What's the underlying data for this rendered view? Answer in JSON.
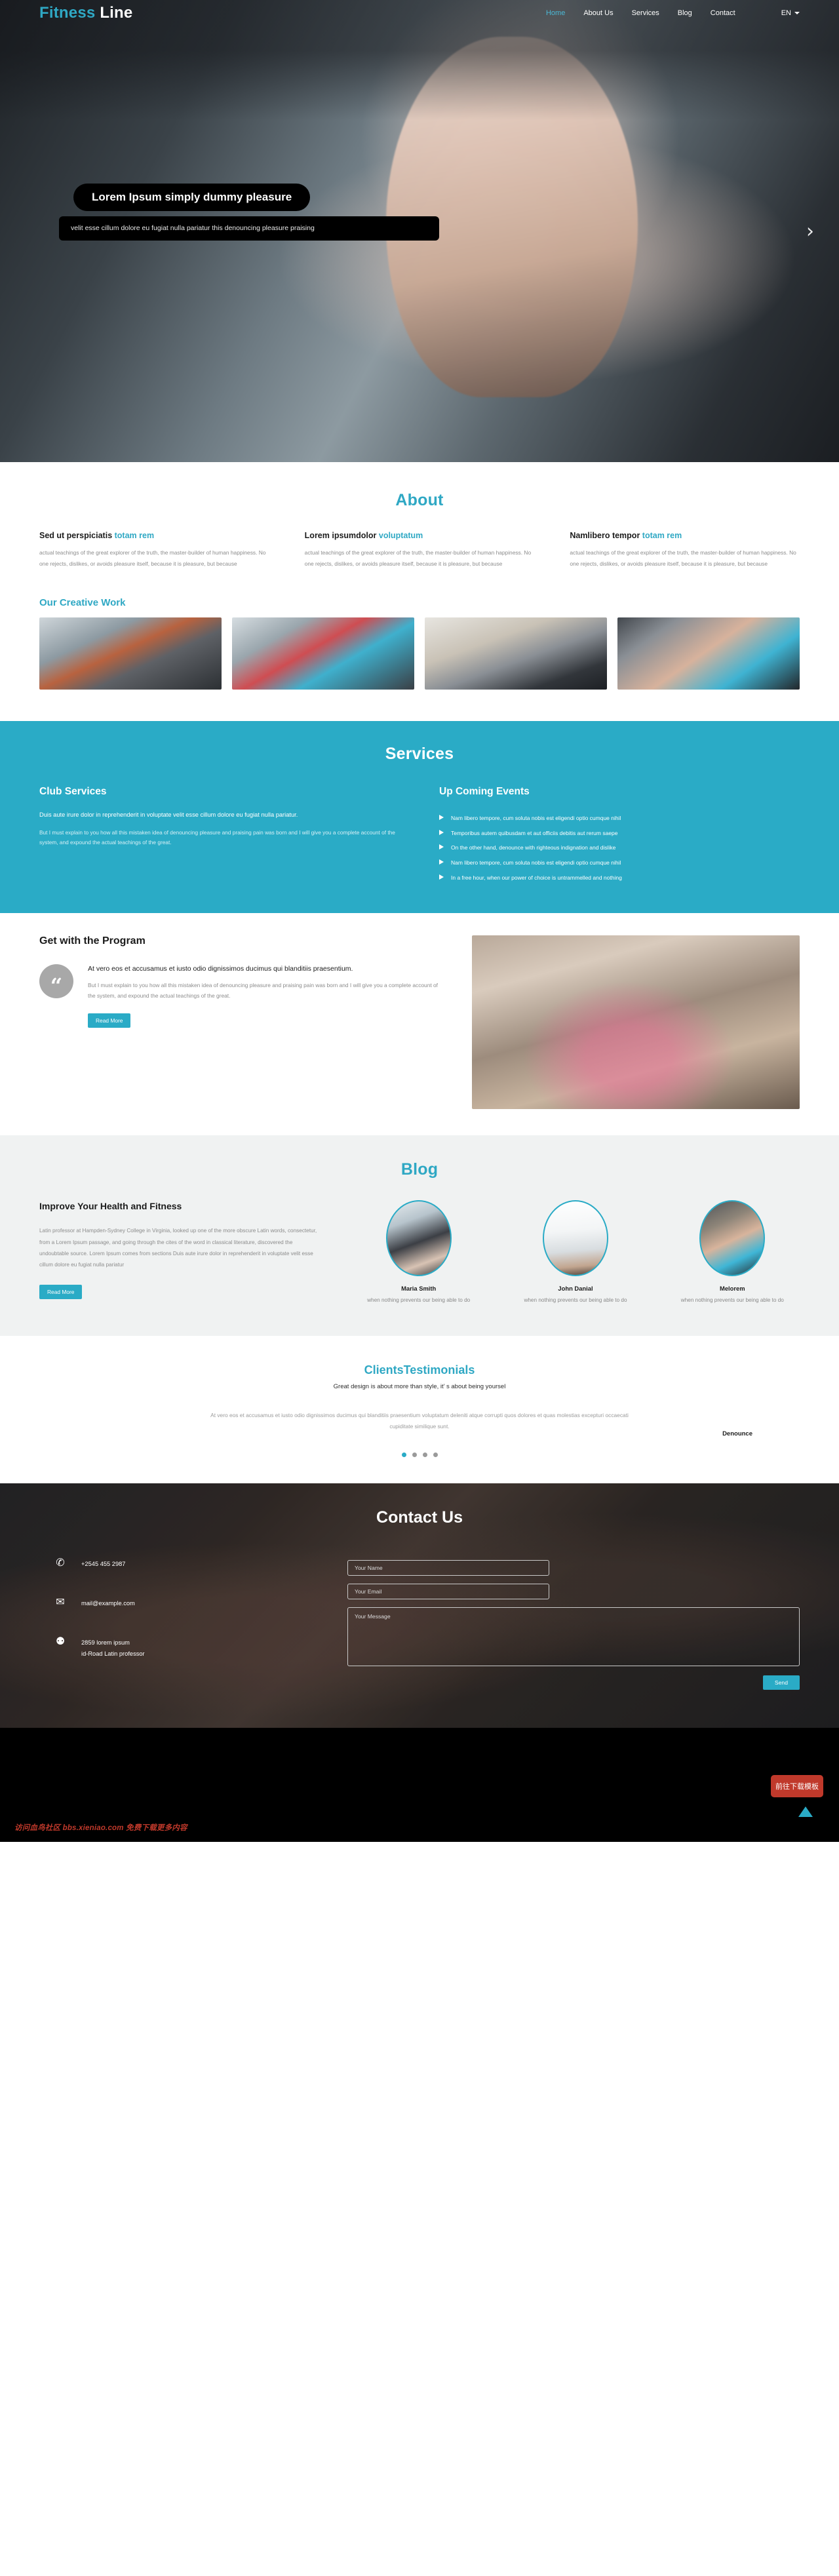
{
  "header": {
    "brand_first": "Fitness",
    "brand_second": "Line",
    "nav": [
      {
        "label": "Home",
        "active": true
      },
      {
        "label": "About Us",
        "active": false
      },
      {
        "label": "Services",
        "active": false
      },
      {
        "label": "Blog",
        "active": false
      },
      {
        "label": "Contact",
        "active": false
      }
    ],
    "lang": "EN"
  },
  "hero": {
    "title": "Lorem Ipsum simply dummy pleasure",
    "subtitle": "velit esse cillum dolore eu fugiat nulla pariatur this denouncing pleasure praising",
    "next_arrow": "›"
  },
  "about": {
    "title": "About",
    "columns": [
      {
        "heading_plain": "Sed ut perspiciatis ",
        "heading_accent": "totam rem",
        "body": "actual teachings of the great explorer of the truth, the master-builder of human happiness. No one rejects, dislikes, or avoids pleasure itself, because it is pleasure, but because"
      },
      {
        "heading_plain": "Lorem ipsumdolor ",
        "heading_accent": "voluptatum",
        "body": "actual teachings of the great explorer of the truth, the master-builder of human happiness. No one rejects, dislikes, or avoids pleasure itself, because it is pleasure, but because"
      },
      {
        "heading_plain": "Namlibero tempor ",
        "heading_accent": "totam rem",
        "body": "actual teachings of the great explorer of the truth, the master-builder of human happiness. No one rejects, dislikes, or avoids pleasure itself, because it is pleasure, but because"
      }
    ],
    "work_title": "Our Creative Work",
    "gallery": [
      {
        "name": "treadmill-gym-photo"
      },
      {
        "name": "barbell-class-photo"
      },
      {
        "name": "crossfit-box-photo"
      },
      {
        "name": "shoulder-press-photo"
      }
    ]
  },
  "services": {
    "title": "Services",
    "club": {
      "heading": "Club Services",
      "lead": "Duis aute irure dolor in reprehenderit in voluptate velit esse cillum dolore eu fugiat nulla pariatur.",
      "body": "But I must explain to you how all this mistaken idea of denouncing pleasure and praising pain was born and I will give you a complete account of the system, and expound the actual teachings of the great."
    },
    "events": {
      "heading": "Up Coming Events",
      "items": [
        "Nam libero tempore, cum soluta nobis est eligendi optio cumque nihil",
        "Temporibus autem quibusdam et aut officiis debitis aut rerum saepe",
        "On the other hand, denounce with righteous indignation and dislike",
        "Nam libero tempore, cum soluta nobis est eligendi optio cumque nihil",
        "In a free hour, when our power of choice is untrammelled and nothing"
      ]
    }
  },
  "program": {
    "heading": "Get with the Program",
    "quote_mark": "“",
    "quote_lead": "At vero eos et accusamus et iusto odio dignissimos ducimus qui blanditiis praesentium.",
    "quote_body": "But I must explain to you how all this mistaken idea of denouncing pleasure and praising pain was born and I will give you a complete account of the system, and expound the actual teachings of the great.",
    "button": "Read More",
    "image_name": "yoga-class-photo"
  },
  "blog": {
    "title": "Blog",
    "heading": "Improve Your Health and Fitness",
    "body": "Latin professor at Hampden-Sydney College in Virginia, looked up one of the more obscure Latin words, consectetur, from a Lorem Ipsum passage, and going through the cites of the word in classical literature, discovered the undoubtable source. Lorem Ipsum comes from sections Duis aute irure dolor in reprehenderit in voluptate velit esse cillum dolore eu fugiat nulla pariatur",
    "button": "Read More",
    "authors": [
      {
        "name": "Maria Smith",
        "caption": "when nothing prevents our being able to do"
      },
      {
        "name": "John Danial",
        "caption": "when nothing prevents our being able to do"
      },
      {
        "name": "Melorem",
        "caption": "when nothing prevents our being able to do"
      }
    ]
  },
  "testimonials": {
    "title": "ClientsTestimonials",
    "subtitle": "Great design is about more than style, it’ s about being yoursel",
    "quote": "At vero eos et accusamus et iusto odio dignissimos ducimus qui blanditiis praesentium voluptatum deleniti atque corrupti quos dolores et quas molestias excepturi occaecati cupiditate similique sunt.",
    "dots": 4,
    "active_dot": 0,
    "side_label": "Denounce"
  },
  "contact": {
    "title": "Contact Us",
    "items": [
      {
        "icon": "phone-icon",
        "glyph": "✆",
        "text": "+2545 455 2987"
      },
      {
        "icon": "mail-icon",
        "glyph": "✉",
        "text": "mail@example.com"
      },
      {
        "icon": "location-pin-icon",
        "glyph": "⚉",
        "text": "2859 lorem ipsum\nid-Road Latin professor"
      }
    ],
    "form": {
      "name_placeholder": "Your Name",
      "name_value": "",
      "email_placeholder": "Your Email",
      "email_value": "",
      "message_placeholder": "Your Message",
      "message_value": "",
      "send_label": "Send"
    }
  },
  "footer": {
    "watermark": "访问血鸟社区 bbs.xieniao.com 免费下载更多内容",
    "download_badge": "前往下载模板",
    "back_to_top": "scroll-top-arrow"
  },
  "colors": {
    "accent": "#2aabc6",
    "accent_text": "#2fa8c4",
    "dark": "#242424",
    "muted": "#8c8c8c"
  }
}
